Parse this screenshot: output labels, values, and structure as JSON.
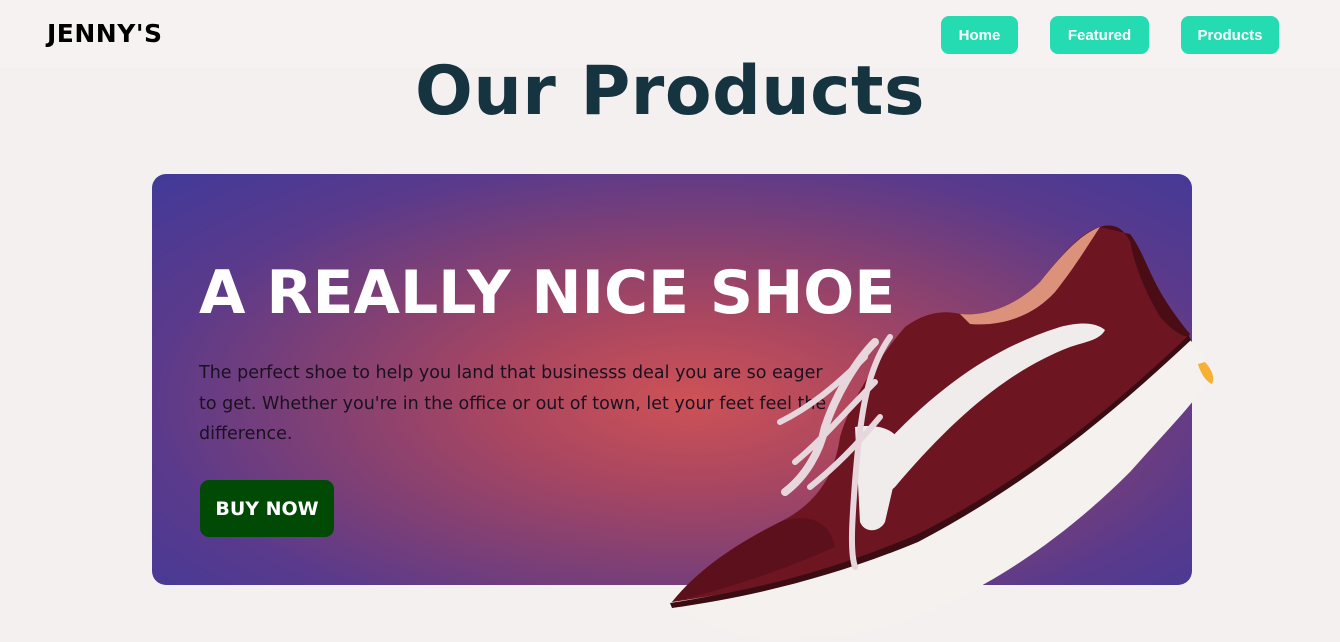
{
  "nav": {
    "brand": "JENNY'S",
    "links": [
      {
        "label": "Home"
      },
      {
        "label": "Featured"
      },
      {
        "label": "Products"
      }
    ]
  },
  "page_title": "Our Products",
  "hero": {
    "heading": "A REALLY NICE SHOE",
    "description": "The perfect shoe to help you land that businesss deal you are so eager to get. Whether you're in the office or out of town, let your feet feel the difference.",
    "cta_label": "BUY NOW",
    "image": "maroon-sneaker-image"
  },
  "colors": {
    "accent": "#25dbb1",
    "title": "#163440",
    "cta": "#014a05",
    "hero_center": "#ce5256",
    "hero_edge": "#433a98"
  }
}
